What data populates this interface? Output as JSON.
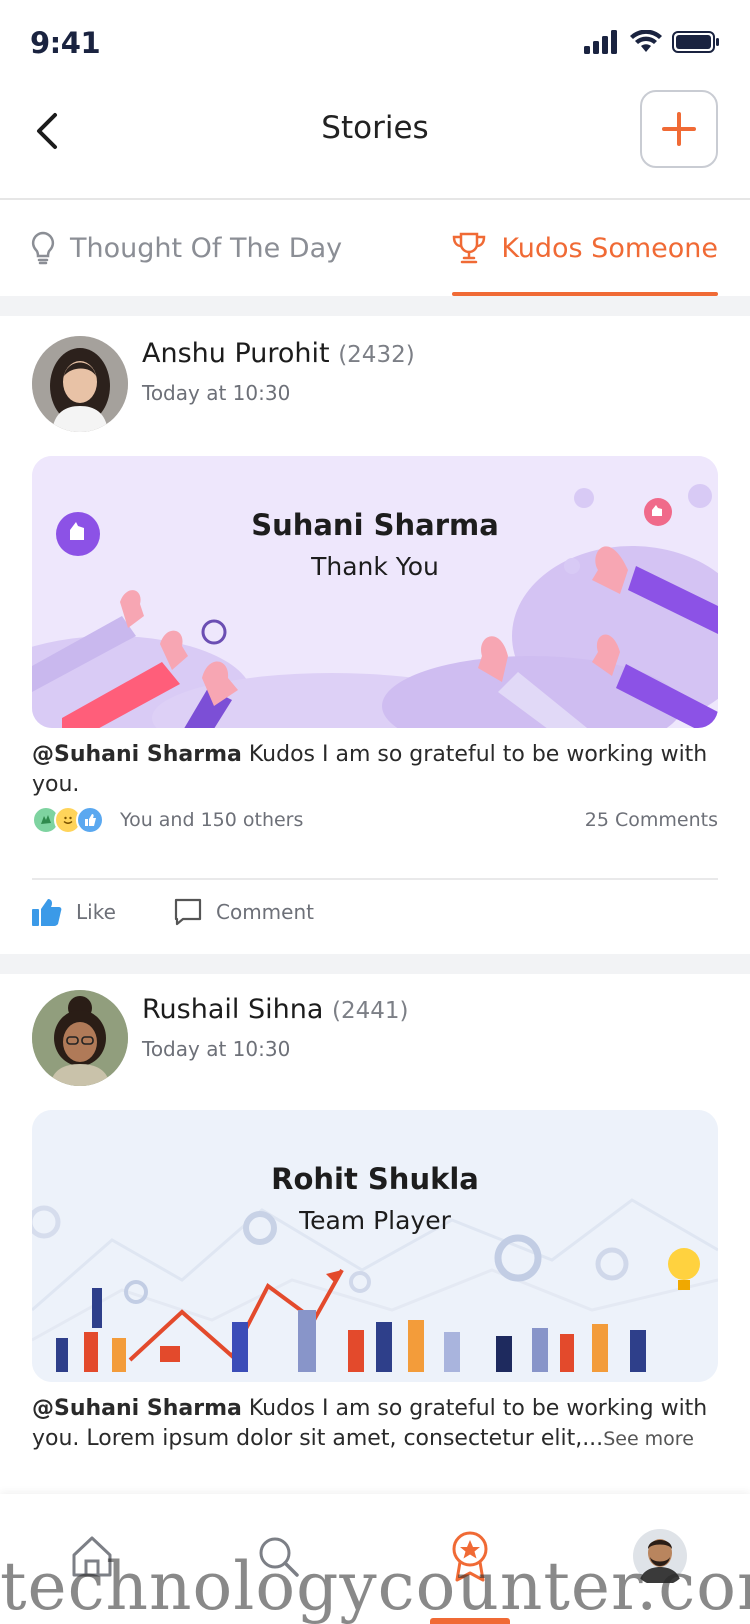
{
  "status_bar": {
    "time": "9:41"
  },
  "header": {
    "title": "Stories"
  },
  "tabs": [
    {
      "label": "Thought Of The Day",
      "icon": "lightbulb-icon",
      "active": false
    },
    {
      "label": "Kudos Someone",
      "icon": "trophy-icon",
      "active": true
    }
  ],
  "accent_color": "#f06a35",
  "posts": [
    {
      "author": "Anshu Purohit",
      "score": "(2432)",
      "time": "Today at 10:30",
      "banner_name": "Suhani Sharma",
      "banner_subtitle": "Thank You",
      "mention": "@Suhani Sharma",
      "text": " Kudos I am so grateful to be working with you.",
      "see_more": "",
      "reactions_text": "You and 150 others",
      "comments": "25 Comments",
      "like_label": "Like",
      "comment_label": "Comment"
    },
    {
      "author": "Rushail Sihna",
      "score": "(2441)",
      "time": "Today at 10:30",
      "banner_name": "Rohit Shukla",
      "banner_subtitle": "Team Player",
      "mention": "@Suhani Sharma",
      "text": " Kudos I am so grateful to be working with you. Lorem ipsum dolor sit amet, consectetur elit,...",
      "see_more": "See more"
    }
  ],
  "bottom_nav": [
    {
      "icon": "home-icon"
    },
    {
      "icon": "search-icon"
    },
    {
      "icon": "award-icon",
      "active": true
    },
    {
      "icon": "profile-avatar"
    }
  ],
  "watermark": "technologycounter.com"
}
